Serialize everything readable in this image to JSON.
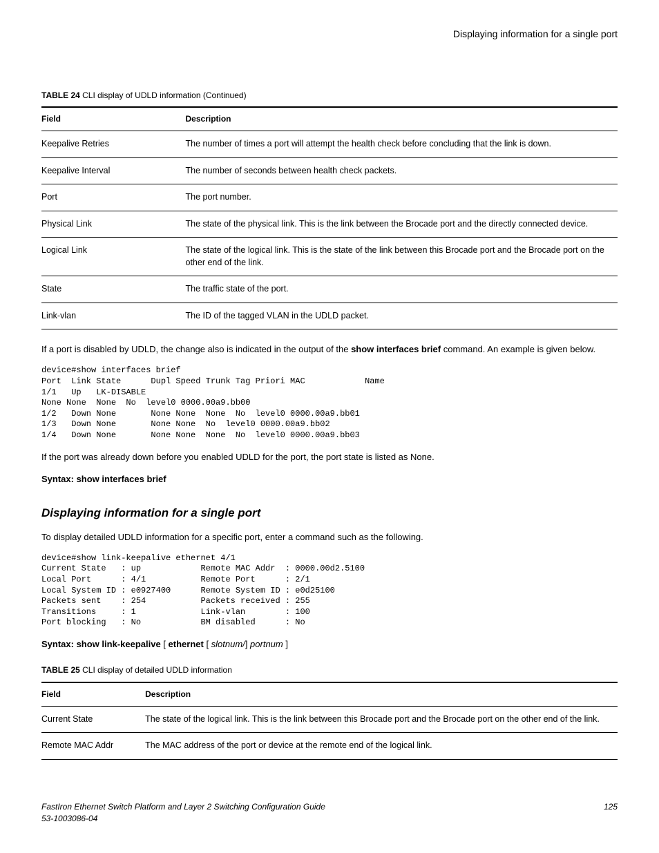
{
  "header": {
    "title": "Displaying information for a single port"
  },
  "table24": {
    "caption_label": "TABLE 24 ",
    "caption_text": " CLI display of UDLD information (Continued)",
    "col1_header": "Field",
    "col2_header": "Description",
    "rows": [
      {
        "field": "Keepalive Retries",
        "desc": "The number of times a port will attempt the health check before concluding that the link is down."
      },
      {
        "field": "Keepalive Interval",
        "desc": "The number of seconds between health check packets."
      },
      {
        "field": "Port",
        "desc": "The port number."
      },
      {
        "field": "Physical Link",
        "desc": "The state of the physical link. This is the link between the Brocade port and the directly connected device."
      },
      {
        "field": "Logical Link",
        "desc": "The state of the logical link. This is the state of the link between this Brocade port and the Brocade port on the other end of the link."
      },
      {
        "field": "State",
        "desc": "The traffic state of the port."
      },
      {
        "field": "Link-vlan",
        "desc": "The ID of the tagged VLAN in the UDLD packet."
      }
    ]
  },
  "para_after_t24_pre": "If a port is disabled by UDLD, the change also is indicated in the output of the ",
  "para_after_t24_bold": "show interfaces brief",
  "para_after_t24_post": " command. An example is given below.",
  "code1": "device#show interfaces brief\nPort  Link State      Dupl Speed Trunk Tag Priori MAC            Name\n1/1   Up   LK-DISABLE\nNone None  None  No  level0 0000.00a9.bb00\n1/2   Down None       None None  None  No  level0 0000.00a9.bb01\n1/3   Down None       None None  No  level0 0000.00a9.bb02\n1/4   Down None       None None  None  No  level0 0000.00a9.bb03",
  "para_after_code1": "If the port was already down before you enabled UDLD for the port, the port state is listed as None.",
  "syntax1": "Syntax: show interfaces brief",
  "section_title": "Displaying information for a single port",
  "para_section": "To display detailed UDLD information for a specific port, enter a command such as the following.",
  "code2": "device#show link-keepalive ethernet 4/1\nCurrent State   : up            Remote MAC Addr  : 0000.00d2.5100\nLocal Port      : 4/1           Remote Port      : 2/1\nLocal System ID : e0927400      Remote System ID : e0d25100\nPackets sent    : 254           Packets received : 255\nTransitions     : 1             Link-vlan        : 100\nPort blocking   : No            BM disabled      : No",
  "syntax2_bold1": "Syntax: show link-keepalive",
  "syntax2_t1": " [ ",
  "syntax2_bold2": "ethernet",
  "syntax2_t2": " [ ",
  "syntax2_ital1": "slotnum/",
  "syntax2_t3": "] ",
  "syntax2_ital2": "portnum",
  "syntax2_t4": " ]",
  "table25": {
    "caption_label": "TABLE 25 ",
    "caption_text": " CLI display of detailed UDLD information",
    "col1_header": "Field",
    "col2_header": "Description",
    "rows": [
      {
        "field": "Current State",
        "desc": "The state of the logical link. This is the link between this Brocade port and the Brocade port on the other end of the link."
      },
      {
        "field": "Remote MAC Addr",
        "desc": "The MAC address of the port or device at the remote end of the logical link."
      }
    ]
  },
  "footer": {
    "left_line1": "FastIron Ethernet Switch Platform and Layer 2 Switching Configuration Guide",
    "left_line2": "53-1003086-04",
    "right": "125"
  }
}
